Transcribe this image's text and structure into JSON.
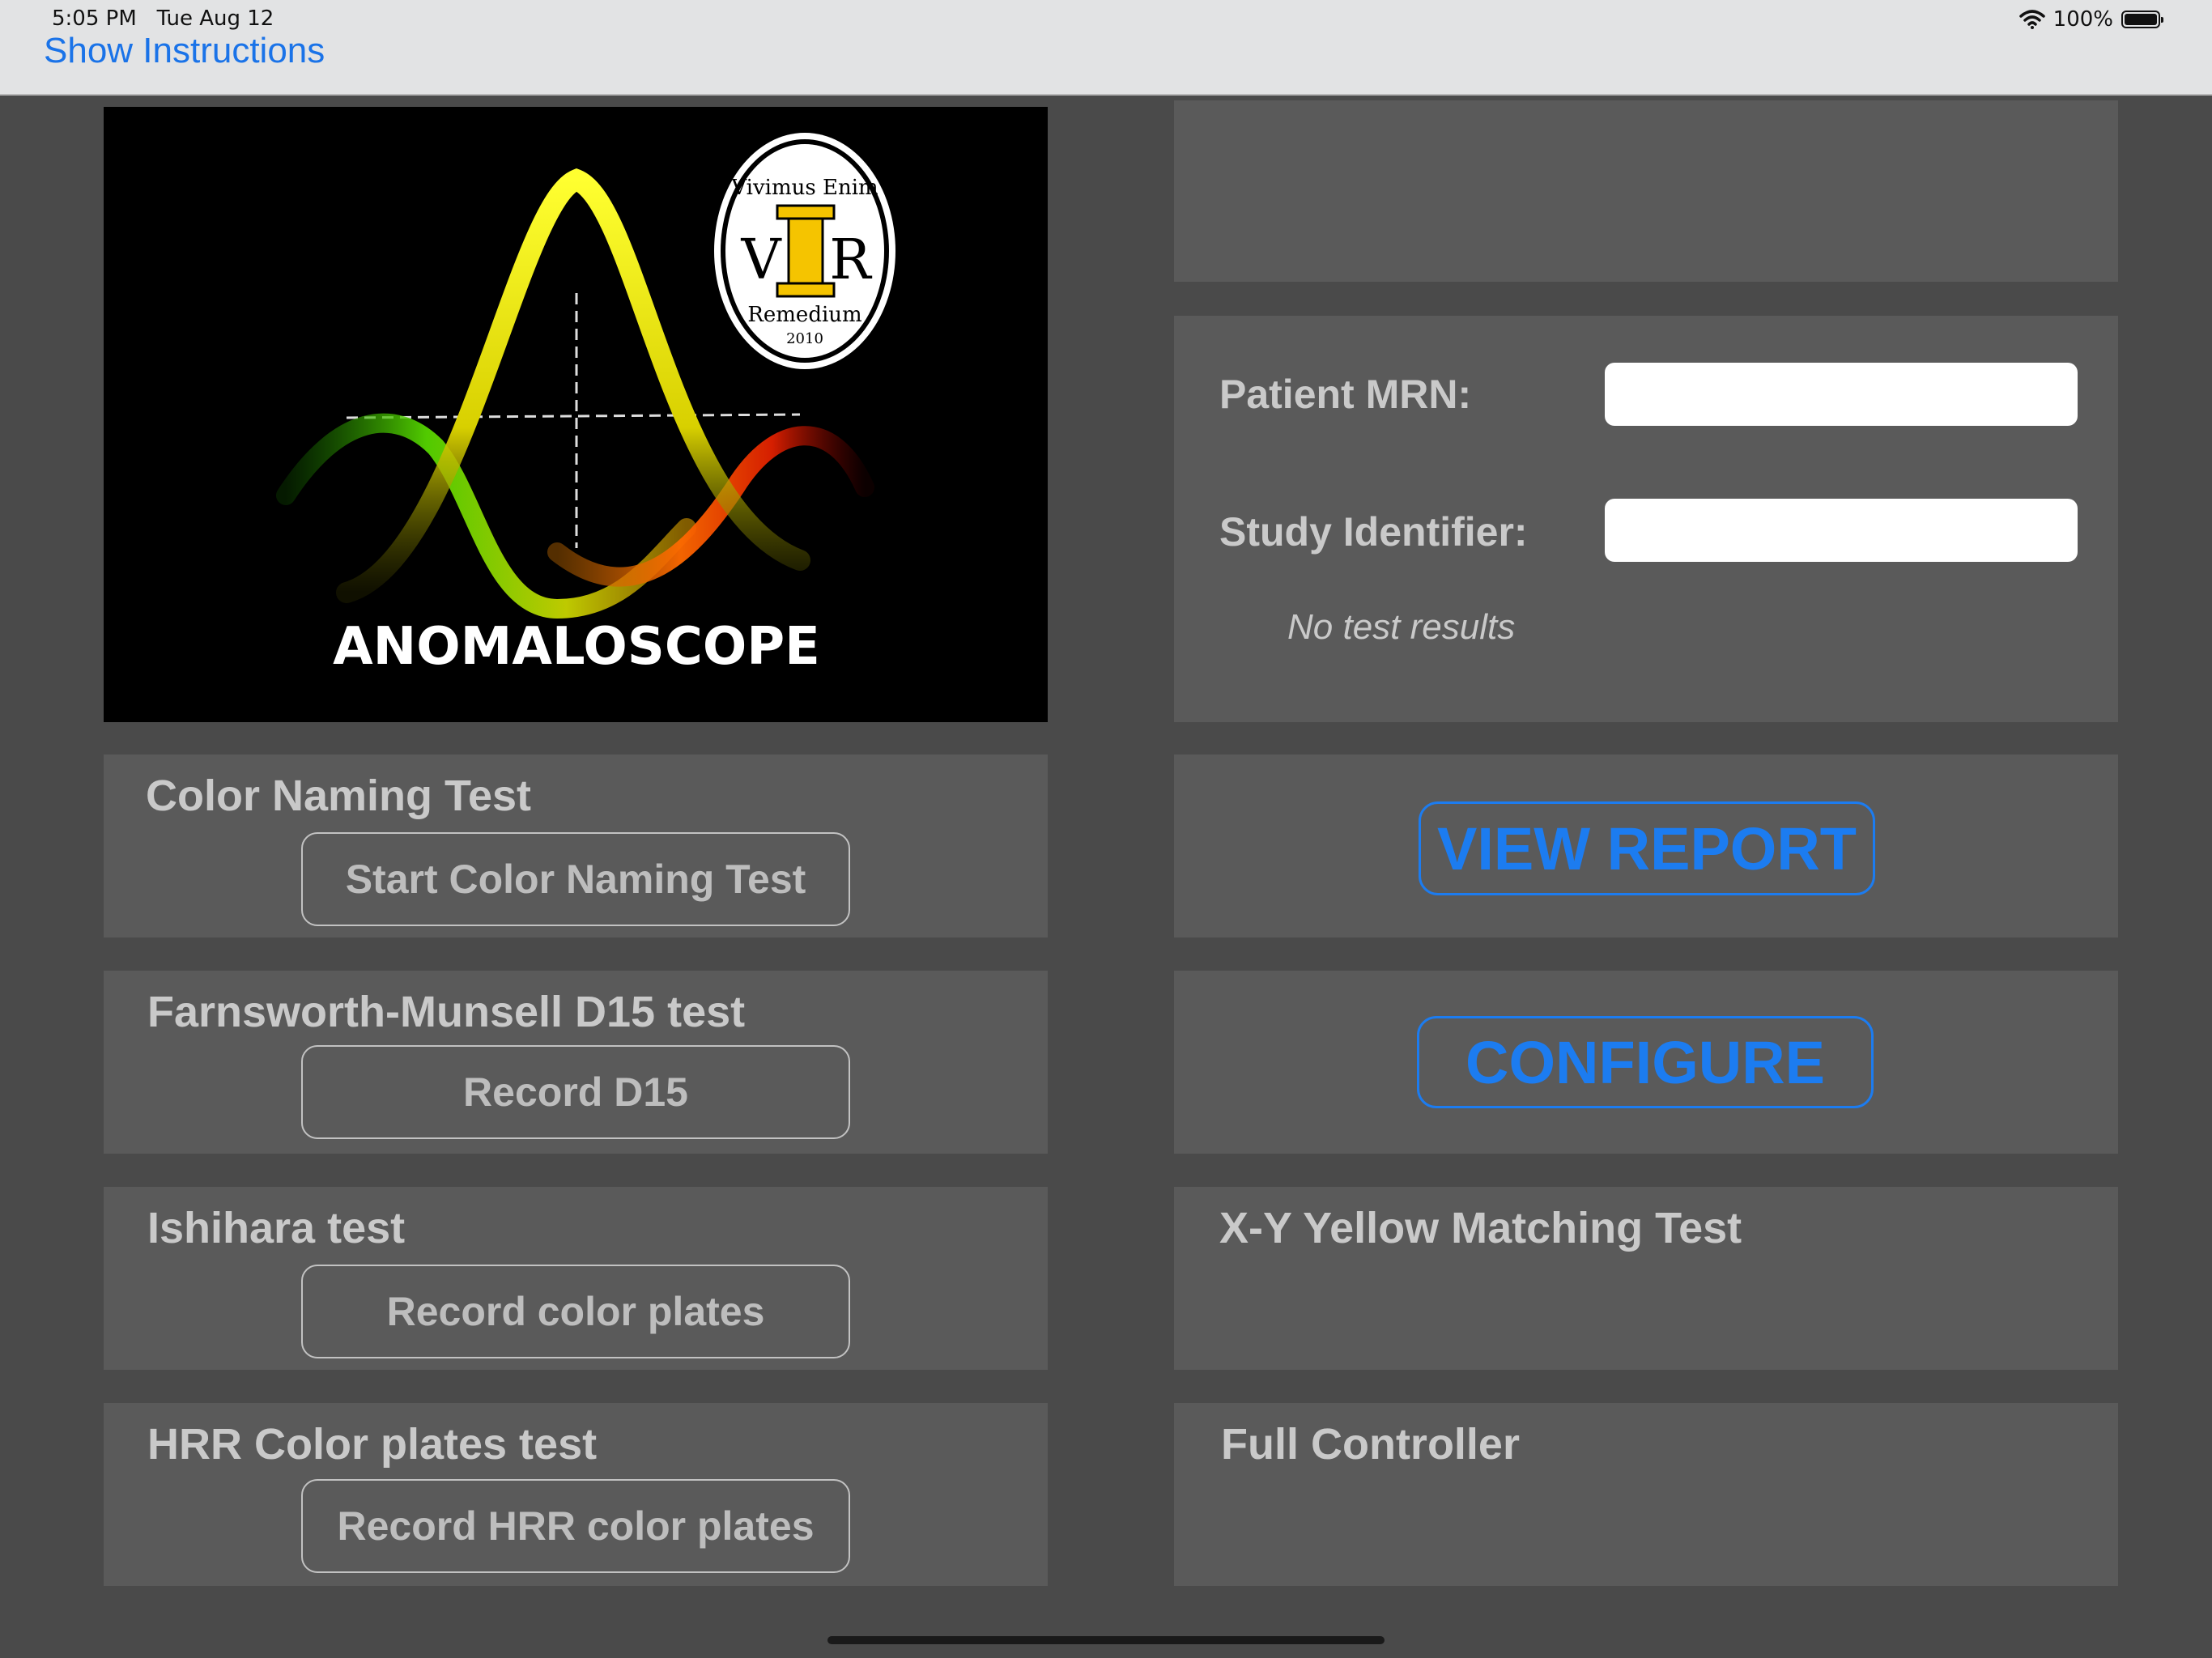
{
  "status_bar": {
    "time": "5:05 PM",
    "date": "Tue Aug 12",
    "battery": "100%"
  },
  "nav": {
    "show_instructions": "Show Instructions"
  },
  "logo": {
    "title": "ANOMALOSCOPE",
    "seal_top": "Vivimus Enim",
    "seal_left": "V",
    "seal_center": "I",
    "seal_right": "R",
    "seal_bottom": "Remedium",
    "seal_year": "2010"
  },
  "patient": {
    "mrn_label": "Patient MRN:",
    "mrn_value": "",
    "study_label": "Study Identifier:",
    "study_value": "",
    "no_results": "No test results"
  },
  "tests": [
    {
      "title": "Color Naming Test",
      "button": "Start Color Naming Test"
    },
    {
      "title": "Farnsworth-Munsell D15 test",
      "button": "Record D15"
    },
    {
      "title": "Ishihara test",
      "button": "Record color plates"
    },
    {
      "title": "HRR Color plates test",
      "button": "Record HRR color plates"
    }
  ],
  "actions": {
    "view_report": "VIEW REPORT",
    "configure": "CONFIGURE"
  },
  "right_sections": {
    "xy_yellow": "X-Y Yellow Matching Test",
    "full_controller": "Full Controller"
  },
  "colors": {
    "accent": "#1c7cf0",
    "panel": "#5a5a5a",
    "background": "#4a4a4a"
  }
}
